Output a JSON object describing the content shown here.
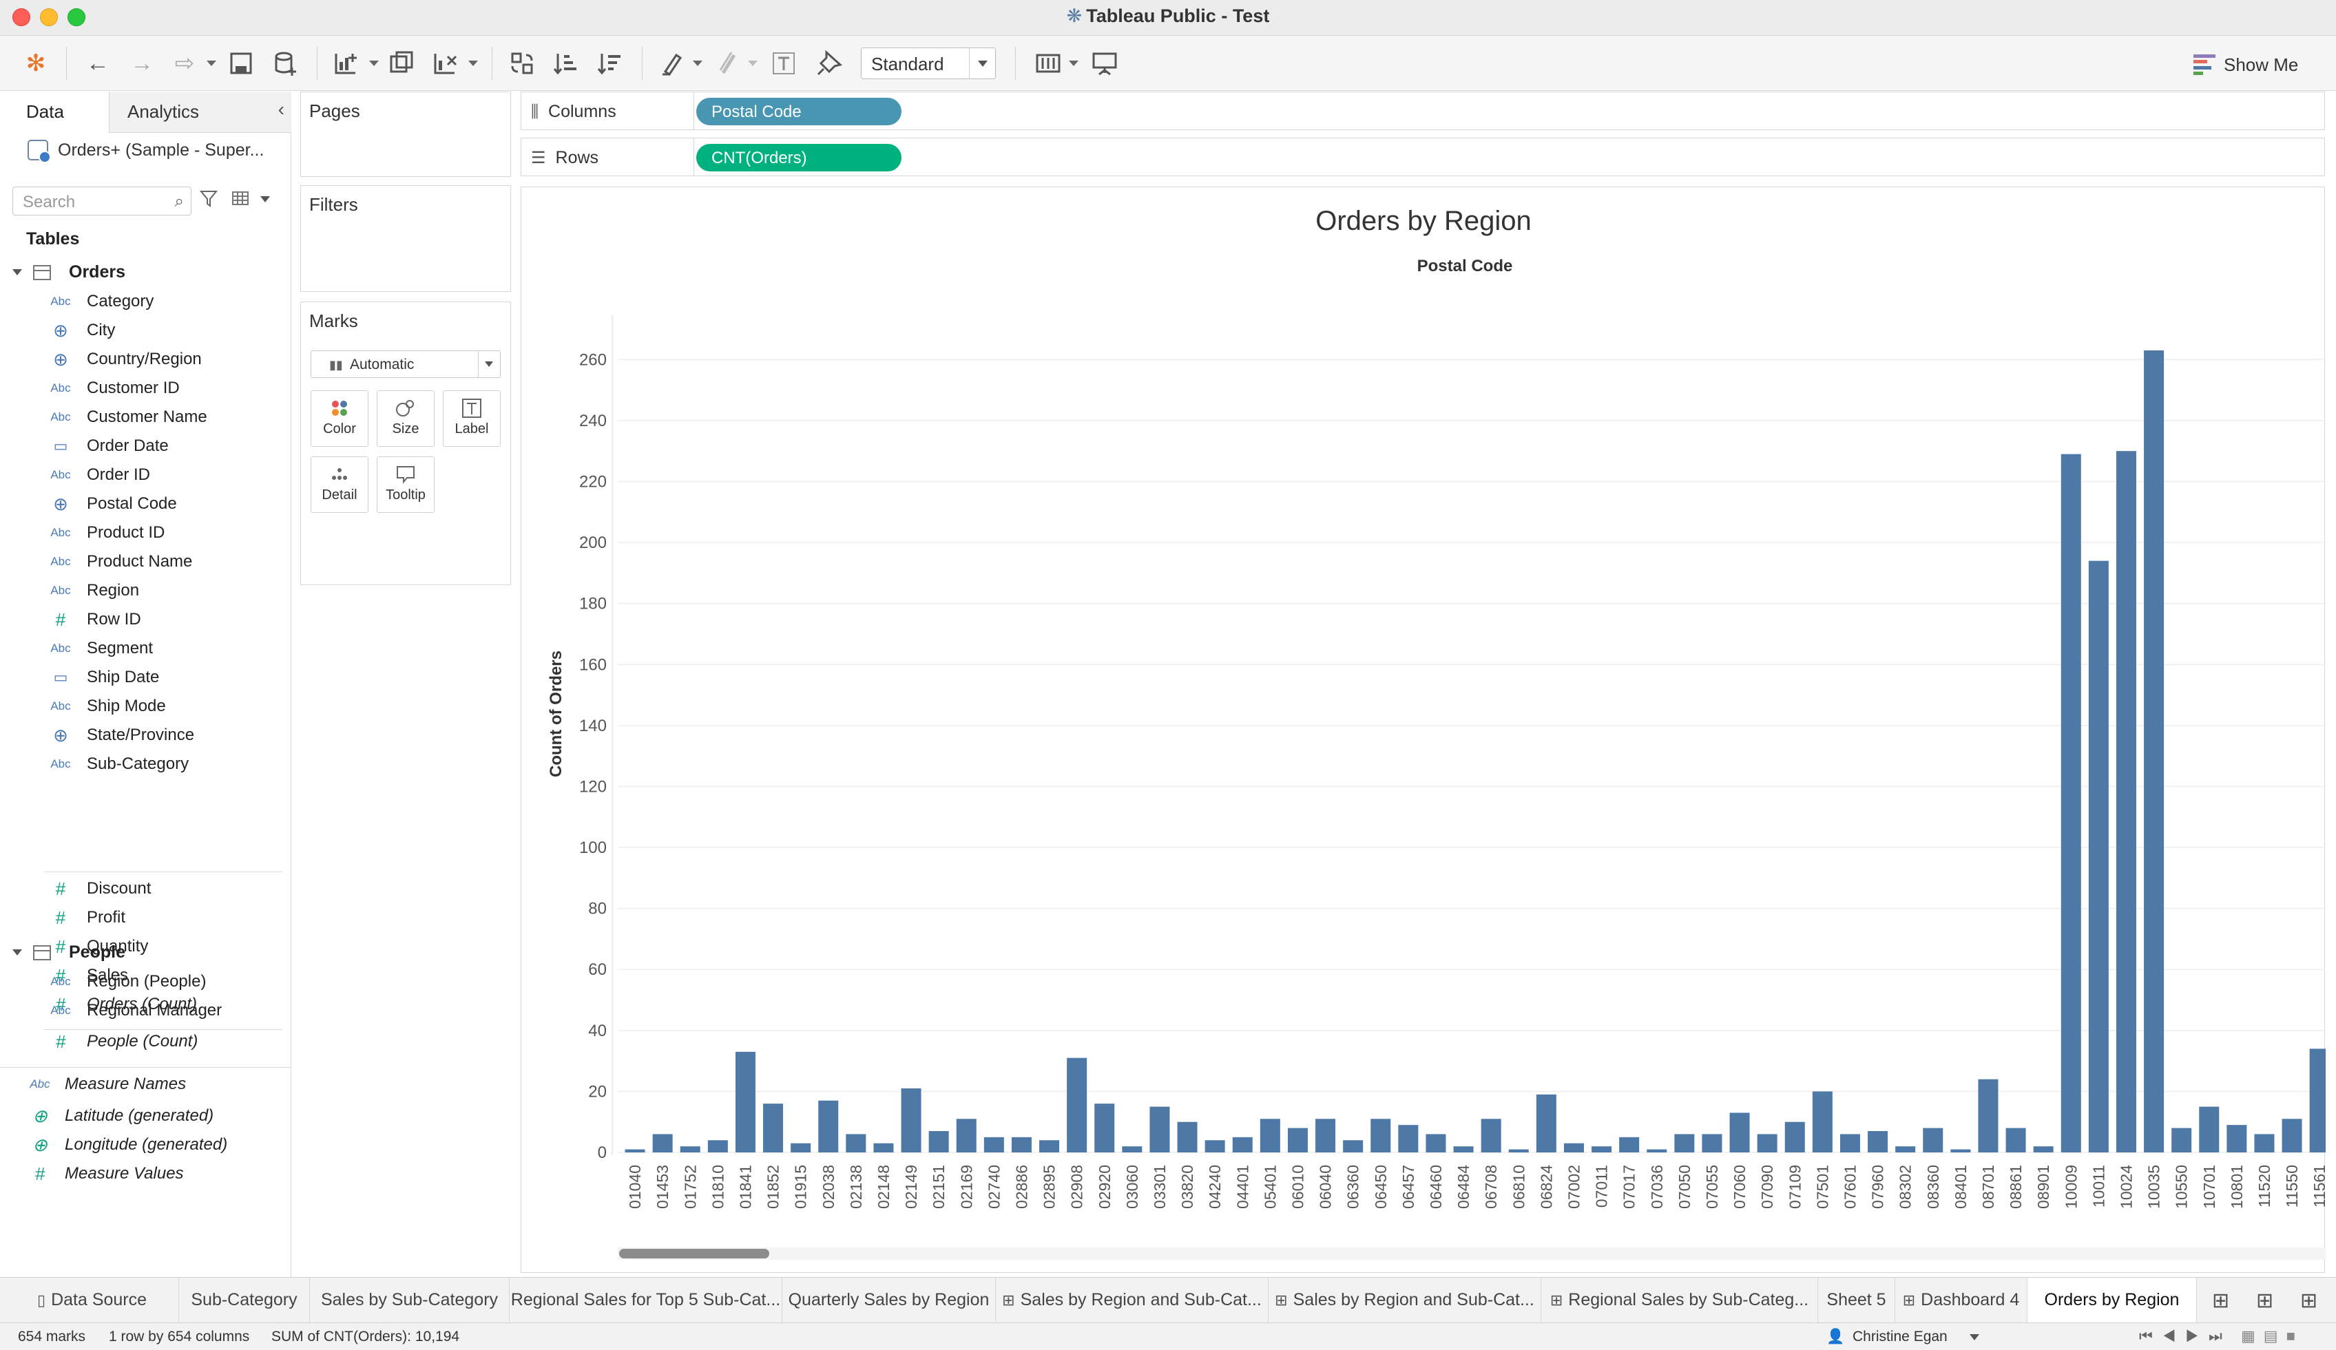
{
  "window": {
    "title": "Tableau Public - Test"
  },
  "toolbar": {
    "fit_select": "Standard",
    "show_me": "Show Me"
  },
  "data_pane": {
    "tabs": [
      "Data",
      "Analytics"
    ],
    "datasource": "Orders+ (Sample - Super...",
    "search_placeholder": "Search",
    "tables_heading": "Tables",
    "orders_group": "Orders",
    "orders_fields": [
      {
        "type": "Abc",
        "name": "Category"
      },
      {
        "type": "geo",
        "name": "City"
      },
      {
        "type": "geo",
        "name": "Country/Region"
      },
      {
        "type": "Abc",
        "name": "Customer ID"
      },
      {
        "type": "Abc",
        "name": "Customer Name"
      },
      {
        "type": "date",
        "name": "Order Date"
      },
      {
        "type": "Abc",
        "name": "Order ID"
      },
      {
        "type": "geo",
        "name": "Postal Code"
      },
      {
        "type": "Abc",
        "name": "Product ID"
      },
      {
        "type": "Abc",
        "name": "Product Name"
      },
      {
        "type": "Abc",
        "name": "Region"
      },
      {
        "type": "#",
        "name": "Row ID"
      },
      {
        "type": "Abc",
        "name": "Segment"
      },
      {
        "type": "date",
        "name": "Ship Date"
      },
      {
        "type": "Abc",
        "name": "Ship Mode"
      },
      {
        "type": "geo",
        "name": "State/Province"
      },
      {
        "type": "Abc",
        "name": "Sub-Category"
      }
    ],
    "orders_measures": [
      "Discount",
      "Profit",
      "Quantity",
      "Sales",
      "Orders (Count)"
    ],
    "people_group": "People",
    "people_fields": [
      "Region (People)",
      "Regional Manager"
    ],
    "people_measure": "People (Count)",
    "extra_fields": [
      "Measure Names",
      "Latitude (generated)",
      "Longitude (generated)",
      "Measure Values"
    ]
  },
  "cards": {
    "pages": "Pages",
    "filters": "Filters",
    "marks": "Marks",
    "marks_type": "Automatic",
    "marks_buttons": [
      "Color",
      "Size",
      "Label",
      "Detail",
      "Tooltip"
    ]
  },
  "shelves": {
    "columns_label": "Columns",
    "columns_pill": "Postal Code",
    "rows_label": "Rows",
    "rows_pill": "CNT(Orders)",
    "columns_color": "#4996b2",
    "rows_color": "#00b180"
  },
  "chart_data": {
    "type": "bar",
    "title": "Orders by Region",
    "xlabel": "Postal Code",
    "ylabel": "Count of Orders",
    "ylim": [
      0,
      270
    ],
    "yticks": [
      0,
      20,
      40,
      60,
      80,
      100,
      120,
      140,
      160,
      180,
      200,
      220,
      240,
      260
    ],
    "bar_color": "#4e79a7",
    "categories": [
      "01040",
      "01453",
      "01752",
      "01810",
      "01841",
      "01852",
      "01915",
      "02038",
      "02138",
      "02148",
      "02149",
      "02151",
      "02169",
      "02740",
      "02886",
      "02895",
      "02908",
      "02920",
      "03060",
      "03301",
      "03820",
      "04240",
      "04401",
      "05401",
      "06010",
      "06040",
      "06360",
      "06450",
      "06457",
      "06460",
      "06484",
      "06708",
      "06810",
      "06824",
      "07002",
      "07011",
      "07017",
      "07036",
      "07050",
      "07055",
      "07060",
      "07090",
      "07109",
      "07501",
      "07601",
      "07960",
      "08302",
      "08360",
      "08401",
      "08701",
      "08861",
      "08901",
      "10009",
      "10011",
      "10024",
      "10035",
      "10550",
      "10701",
      "10801",
      "11520",
      "11550",
      "11561"
    ],
    "values": [
      1,
      6,
      2,
      4,
      33,
      16,
      3,
      17,
      6,
      3,
      21,
      7,
      11,
      5,
      5,
      4,
      31,
      16,
      2,
      15,
      10,
      4,
      5,
      11,
      8,
      11,
      4,
      11,
      9,
      6,
      2,
      11,
      1,
      19,
      3,
      2,
      5,
      1,
      6,
      6,
      13,
      6,
      10,
      20,
      6,
      7,
      2,
      8,
      1,
      24,
      8,
      2,
      229,
      194,
      230,
      263,
      8,
      15,
      9,
      6,
      11,
      34
    ]
  },
  "sheet_tabs": [
    {
      "label": "Data Source",
      "icon": "db-icon"
    },
    {
      "label": "Sub-Category"
    },
    {
      "label": "Sales by Sub-Category"
    },
    {
      "label": "Regional Sales for Top 5 Sub-Cat..."
    },
    {
      "label": "Quarterly Sales by Region"
    },
    {
      "label": "Sales by Region and Sub-Cat...",
      "icon": "grid-icon"
    },
    {
      "label": "Sales by Region and Sub-Cat...",
      "icon": "grid-icon"
    },
    {
      "label": "Regional Sales by Sub-Categ...",
      "icon": "grid-icon"
    },
    {
      "label": "Sheet 5"
    },
    {
      "label": "Dashboard 4",
      "icon": "grid-icon"
    },
    {
      "label": "Orders by Region",
      "active": true
    }
  ],
  "status": {
    "marks": "654 marks",
    "dims": "1 row by 654 columns",
    "sum": "SUM of CNT(Orders): 10,194",
    "user": "Christine Egan"
  }
}
